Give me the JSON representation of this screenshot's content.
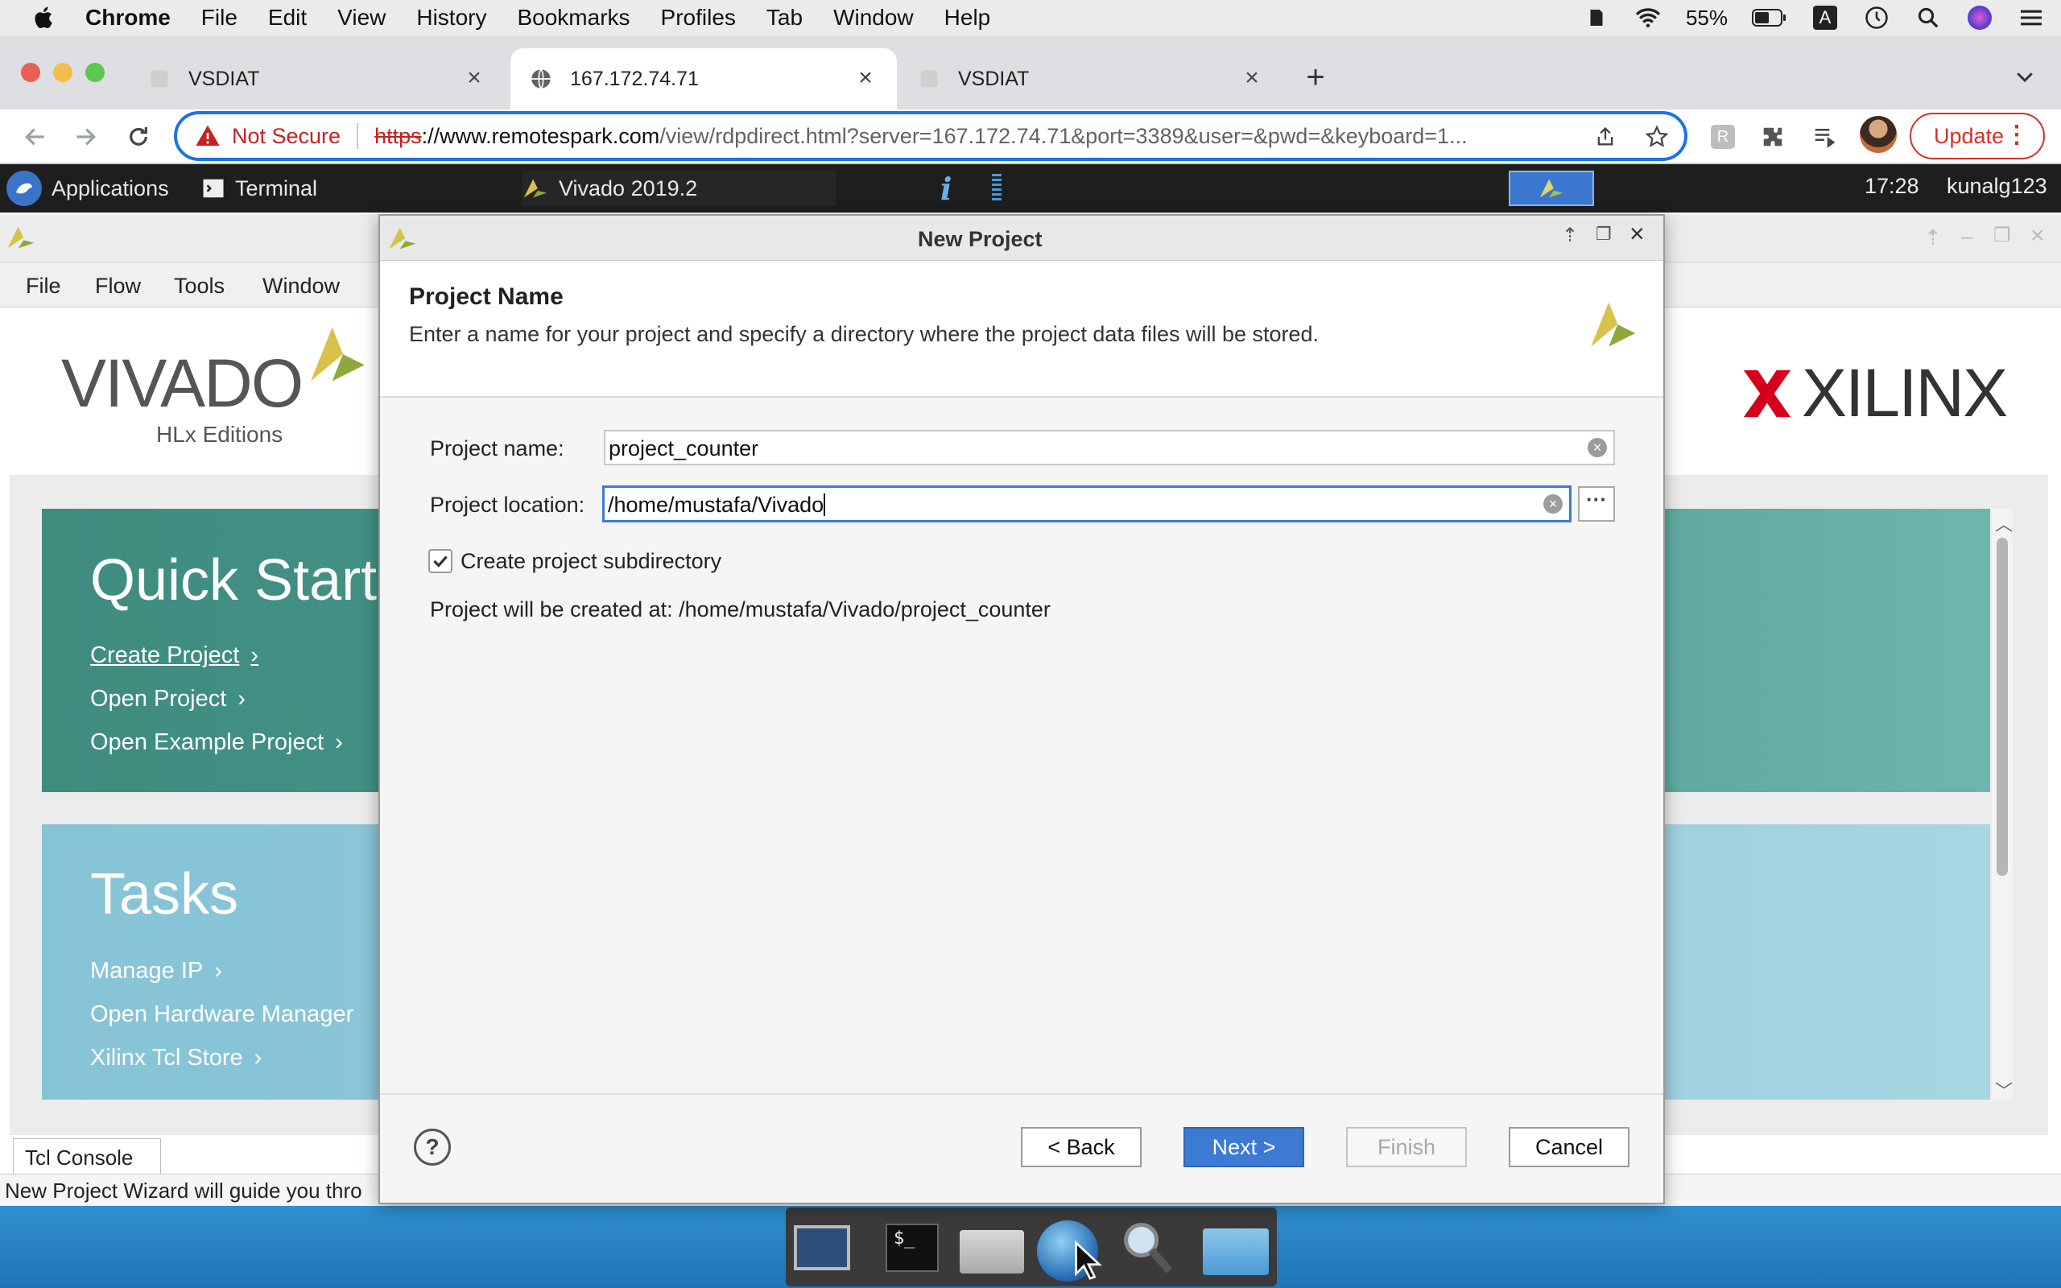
{
  "mac_menubar": {
    "app": "Chrome",
    "items": [
      "File",
      "Edit",
      "View",
      "History",
      "Bookmarks",
      "Profiles",
      "Tab",
      "Window",
      "Help"
    ],
    "battery": "55%"
  },
  "browser": {
    "tabs": [
      {
        "title": "VSDIAT"
      },
      {
        "title": "167.172.74.71"
      },
      {
        "title": "VSDIAT"
      }
    ],
    "omnibox": {
      "security_label": "Not Secure",
      "scheme": "https",
      "host": "://www.remotespark.com",
      "path": "/view/rdpdirect.html?server=167.172.74.71&port=3389&user=&pwd=&keyboard=1..."
    },
    "update_label": "Update"
  },
  "remote_panel": {
    "applications_label": "Applications",
    "tasks": [
      "Terminal",
      "Vivado 2019.2"
    ],
    "clock": "17:28",
    "user": "kunalg123"
  },
  "vivado": {
    "menu": [
      "File",
      "Flow",
      "Tools",
      "Window"
    ],
    "logo": {
      "name": "VIVADO",
      "sub": "HLx Editions"
    },
    "brand": "XILINX",
    "quick_start": {
      "heading": "Quick Start",
      "links": [
        "Create Project",
        "Open Project",
        "Open Example Project"
      ]
    },
    "tasks": {
      "heading": "Tasks",
      "links": [
        "Manage IP",
        "Open Hardware Manager",
        "Xilinx Tcl Store"
      ]
    },
    "tcl_tab": "Tcl Console",
    "status_text": "New Project Wizard will guide you thro"
  },
  "dialog": {
    "title": "New Project",
    "heading": "Project Name",
    "description": "Enter a name for your project and specify a directory where the project data files will be stored.",
    "project_name_label": "Project name:",
    "project_name_value": "project_counter",
    "project_location_label": "Project location:",
    "project_location_value": "/home/mustafa/Vivado",
    "subdir_label": "Create project subdirectory",
    "subdir_checked": true,
    "created_at_label": "Project will be created at:",
    "created_at_value": "/home/mustafa/Vivado/project_counter",
    "buttons": {
      "back": "< Back",
      "next": "Next >",
      "finish": "Finish",
      "cancel": "Cancel"
    }
  },
  "colors": {
    "chrome_accent": "#1a73e8",
    "not_secure": "#c5221f",
    "quick_start_bg": "#4a9b8f",
    "tasks_bg": "#93cbdc",
    "primary_button": "#3d7ad4",
    "xilinx_red": "#d6001c"
  },
  "icons": [
    "apple-icon",
    "wifi-icon",
    "battery-icon",
    "search-icon",
    "globe-icon",
    "share-icon",
    "star-icon",
    "puzzle-icon",
    "vivado-icon",
    "terminal-icon",
    "help-icon",
    "checkbox-checked-icon"
  ]
}
